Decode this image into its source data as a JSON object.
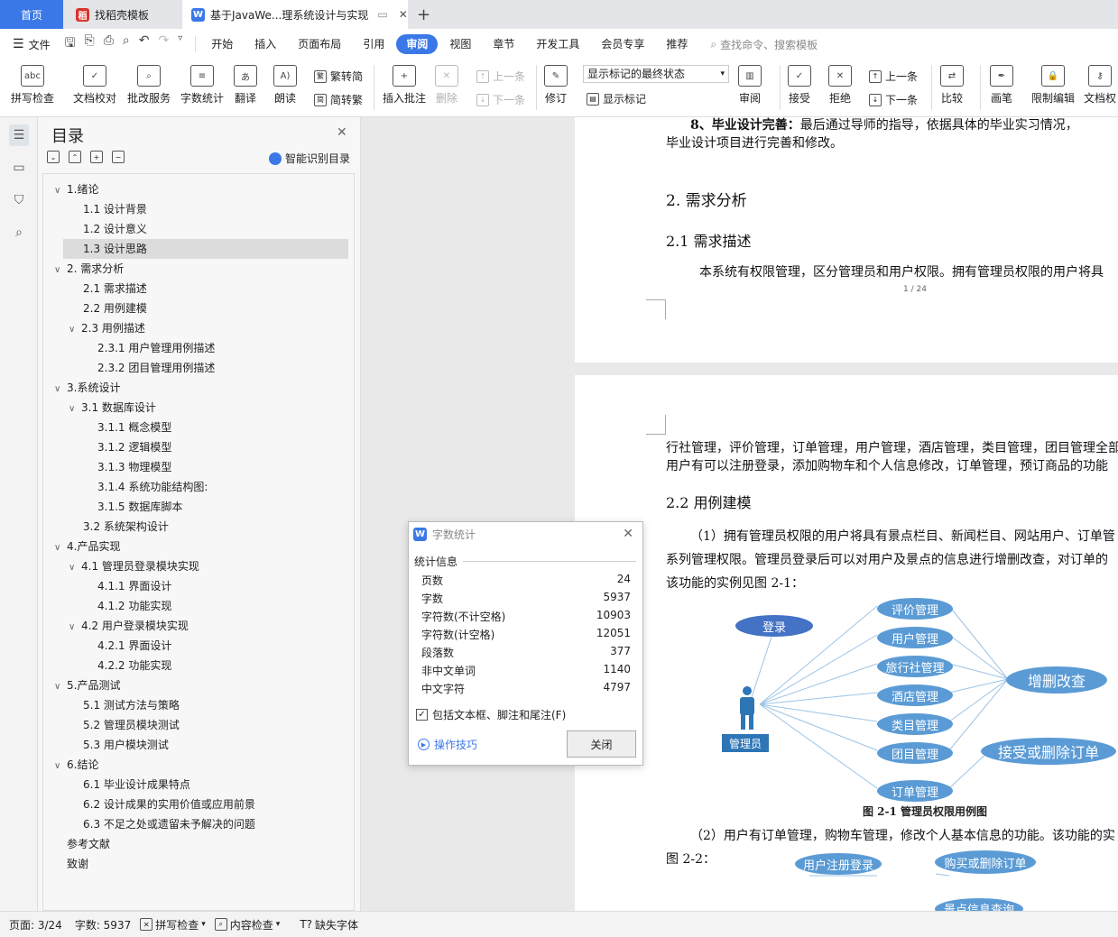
{
  "tabs": {
    "home": "首页",
    "template": "找稻壳模板",
    "doc": "基于JavaWe...理系统设计与实现",
    "new": "+"
  },
  "menu": {
    "file": "文件",
    "items": [
      "开始",
      "插入",
      "页面布局",
      "引用",
      "审阅",
      "视图",
      "章节",
      "开发工具",
      "会员专享",
      "推荐"
    ],
    "active_index": 4,
    "search": "查找命令、搜索模板"
  },
  "toolbar": {
    "spell": "拼写检查",
    "proof": "文档校对",
    "review_service": "批改服务",
    "word_count": "字数统计",
    "translate": "翻译",
    "read": "朗读",
    "to_simp": "繁转简",
    "to_trad": "简转繁",
    "insert_comment": "插入批注",
    "delete": "删除",
    "prev": "上一条",
    "next": "下一条",
    "revise": "修订",
    "markup_select": "显示标记的最终状态",
    "show_markup": "显示标记",
    "review_pane": "审阅",
    "accept": "接受",
    "reject": "拒绝",
    "prev2": "上一条",
    "next2": "下一条",
    "compare": "比较",
    "pen": "画笔",
    "restrict": "限制编辑",
    "doc_perm": "文档权"
  },
  "toc": {
    "title": "目录",
    "smart": "智能识别目录",
    "items": [
      {
        "text": "1.绪论",
        "level": 0,
        "arrow": true
      },
      {
        "text": "1.1 设计背景",
        "level": 1
      },
      {
        "text": "1.2 设计意义",
        "level": 1
      },
      {
        "text": "1.3 设计思路",
        "level": 1,
        "selected": true
      },
      {
        "text": "2. 需求分析",
        "level": 0,
        "arrow": true
      },
      {
        "text": "2.1  需求描述",
        "level": 1
      },
      {
        "text": "2.2  用例建模",
        "level": 1
      },
      {
        "text": "2.3  用例描述",
        "level": 1,
        "arrow": true
      },
      {
        "text": "2.3.1  用户管理用例描述",
        "level": 2
      },
      {
        "text": "2.3.2  团目管理用例描述",
        "level": 2
      },
      {
        "text": "3.系统设计",
        "level": 0,
        "arrow": true
      },
      {
        "text": "3.1  数据库设计",
        "level": 1,
        "arrow": true
      },
      {
        "text": "3.1.1  概念模型",
        "level": 2
      },
      {
        "text": "3.1.2  逻辑模型",
        "level": 2
      },
      {
        "text": "3.1.3  物理模型",
        "level": 2
      },
      {
        "text": "3.1.4  系统功能结构图:",
        "level": 2
      },
      {
        "text": "3.1.5  数据库脚本",
        "level": 2
      },
      {
        "text": "3.2  系统架构设计",
        "level": 1
      },
      {
        "text": "4.产品实现",
        "level": 0,
        "arrow": true
      },
      {
        "text": "4.1  管理员登录模块实现",
        "level": 1,
        "arrow": true
      },
      {
        "text": "4.1.1  界面设计",
        "level": 2
      },
      {
        "text": "4.1.2  功能实现",
        "level": 2
      },
      {
        "text": "4.2  用户登录模块实现",
        "level": 1,
        "arrow": true
      },
      {
        "text": "4.2.1  界面设计",
        "level": 2
      },
      {
        "text": "4.2.2  功能实现",
        "level": 2
      },
      {
        "text": "5.产品测试",
        "level": 0,
        "arrow": true
      },
      {
        "text": "5.1  测试方法与策略",
        "level": 1
      },
      {
        "text": "5.2 管理员模块测试",
        "level": 1
      },
      {
        "text": "5.3  用户模块测试",
        "level": 1
      },
      {
        "text": "6.结论",
        "level": 0,
        "arrow": true
      },
      {
        "text": "6.1 毕业设计成果特点",
        "level": 1
      },
      {
        "text": "6.2 设计成果的实用价值或应用前景",
        "level": 1
      },
      {
        "text": "6.3 不足之处或遗留未予解决的问题",
        "level": 1
      },
      {
        "text": "参考文献",
        "level": 0
      },
      {
        "text": "致谢",
        "level": 0
      }
    ]
  },
  "doc": {
    "p1_line1_bold": "8、毕业设计完善：",
    "p1_line1": "最后通过导师的指导，依据具体的毕业实习情况，",
    "p1_line2": "毕业设计项目进行完善和修改。",
    "h_2": "2.  需求分析",
    "h_21": "2.1  需求描述",
    "p2": "本系统有权限管理，区分管理员和用户权限。拥有管理员权限的用户将具",
    "page_num": "1 / 24",
    "p3_line1": "行社管理，评价管理，订单管理，用户管理，酒店管理，类目管理，团目管理全部",
    "p3_line2": "用户有可以注册登录，添加购物车和个人信息修改，订单管理，预订商品的功能",
    "h_22": "2.2  用例建模",
    "p4_line1": "（1）拥有管理员权限的用户将具有景点栏目、新闻栏目、网站用户、订单管",
    "p4_line2": "系列管理权限。管理员登录后可以对用户及景点的信息进行增删改查，对订单的",
    "p4_line3": "该功能的实例见图 2-1：",
    "fig_caption": "图 2-1 管理员权限用例图",
    "p5_line1": "（2）用户有订单管理，购物车管理，修改个人基本信息的功能。该功能的实",
    "p5_line2": "图 2-2：",
    "diagram1": {
      "actor": "管理员",
      "login": "登录",
      "cases": [
        "评价管理",
        "用户管理",
        "旅行社管理",
        "酒店管理",
        "类目管理",
        "团目管理",
        "订单管理"
      ],
      "crud": "增删改查",
      "accept": "接受或删除订单"
    },
    "diagram2": {
      "register": "用户注册登录",
      "buy": "购买或删除订单",
      "scenic": "景点信息查询"
    }
  },
  "dialog": {
    "title": "字数统计",
    "section": "统计信息",
    "rows": [
      {
        "label": "页数",
        "value": "24"
      },
      {
        "label": "字数",
        "value": "5937"
      },
      {
        "label": "字符数(不计空格)",
        "value": "10903"
      },
      {
        "label": "字符数(计空格)",
        "value": "12051"
      },
      {
        "label": "段落数",
        "value": "377"
      },
      {
        "label": "非中文单词",
        "value": "1140"
      },
      {
        "label": "中文字符",
        "value": "4797"
      }
    ],
    "checkbox": "包括文本框、脚注和尾注(F)",
    "tips": "操作技巧",
    "close": "关闭"
  },
  "status": {
    "page": "页面: 3/24",
    "words": "字数: 5937",
    "spell": "拼写检查",
    "content": "内容检查",
    "font": "缺失字体"
  },
  "colors": {
    "accent": "#3b78e7",
    "diagram": "#5b9bd5",
    "actor": "#2e75b6"
  }
}
